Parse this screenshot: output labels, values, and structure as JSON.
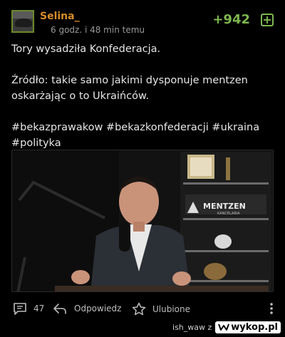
{
  "post": {
    "username": "Selina_",
    "time": "6 godz. i 48 min temu",
    "score": "+942",
    "plus_symbol": "+",
    "lines": [
      "Tory wysadziła Konfederacja.",
      "Źródło: takie samo jakimi dysponuje mentzen oskarżając o to Ukraińców.",
      "#bekazprawakow #bekazkonfederacji #ukraina #polityka"
    ]
  },
  "media": {
    "sign_main": "MENTZEN",
    "sign_sub": "KANCELARIA"
  },
  "actions": {
    "comments_count": "47",
    "reply_label": "Odpowiedz",
    "favorite_label": "Ulubione",
    "more_icon": "vertical-dots-icon"
  },
  "watermark": {
    "prefix": "ish_waw z",
    "site": "wykop.pl"
  },
  "colors": {
    "username": "#d98c2c",
    "score": "#7db64f",
    "background": "#000000"
  }
}
